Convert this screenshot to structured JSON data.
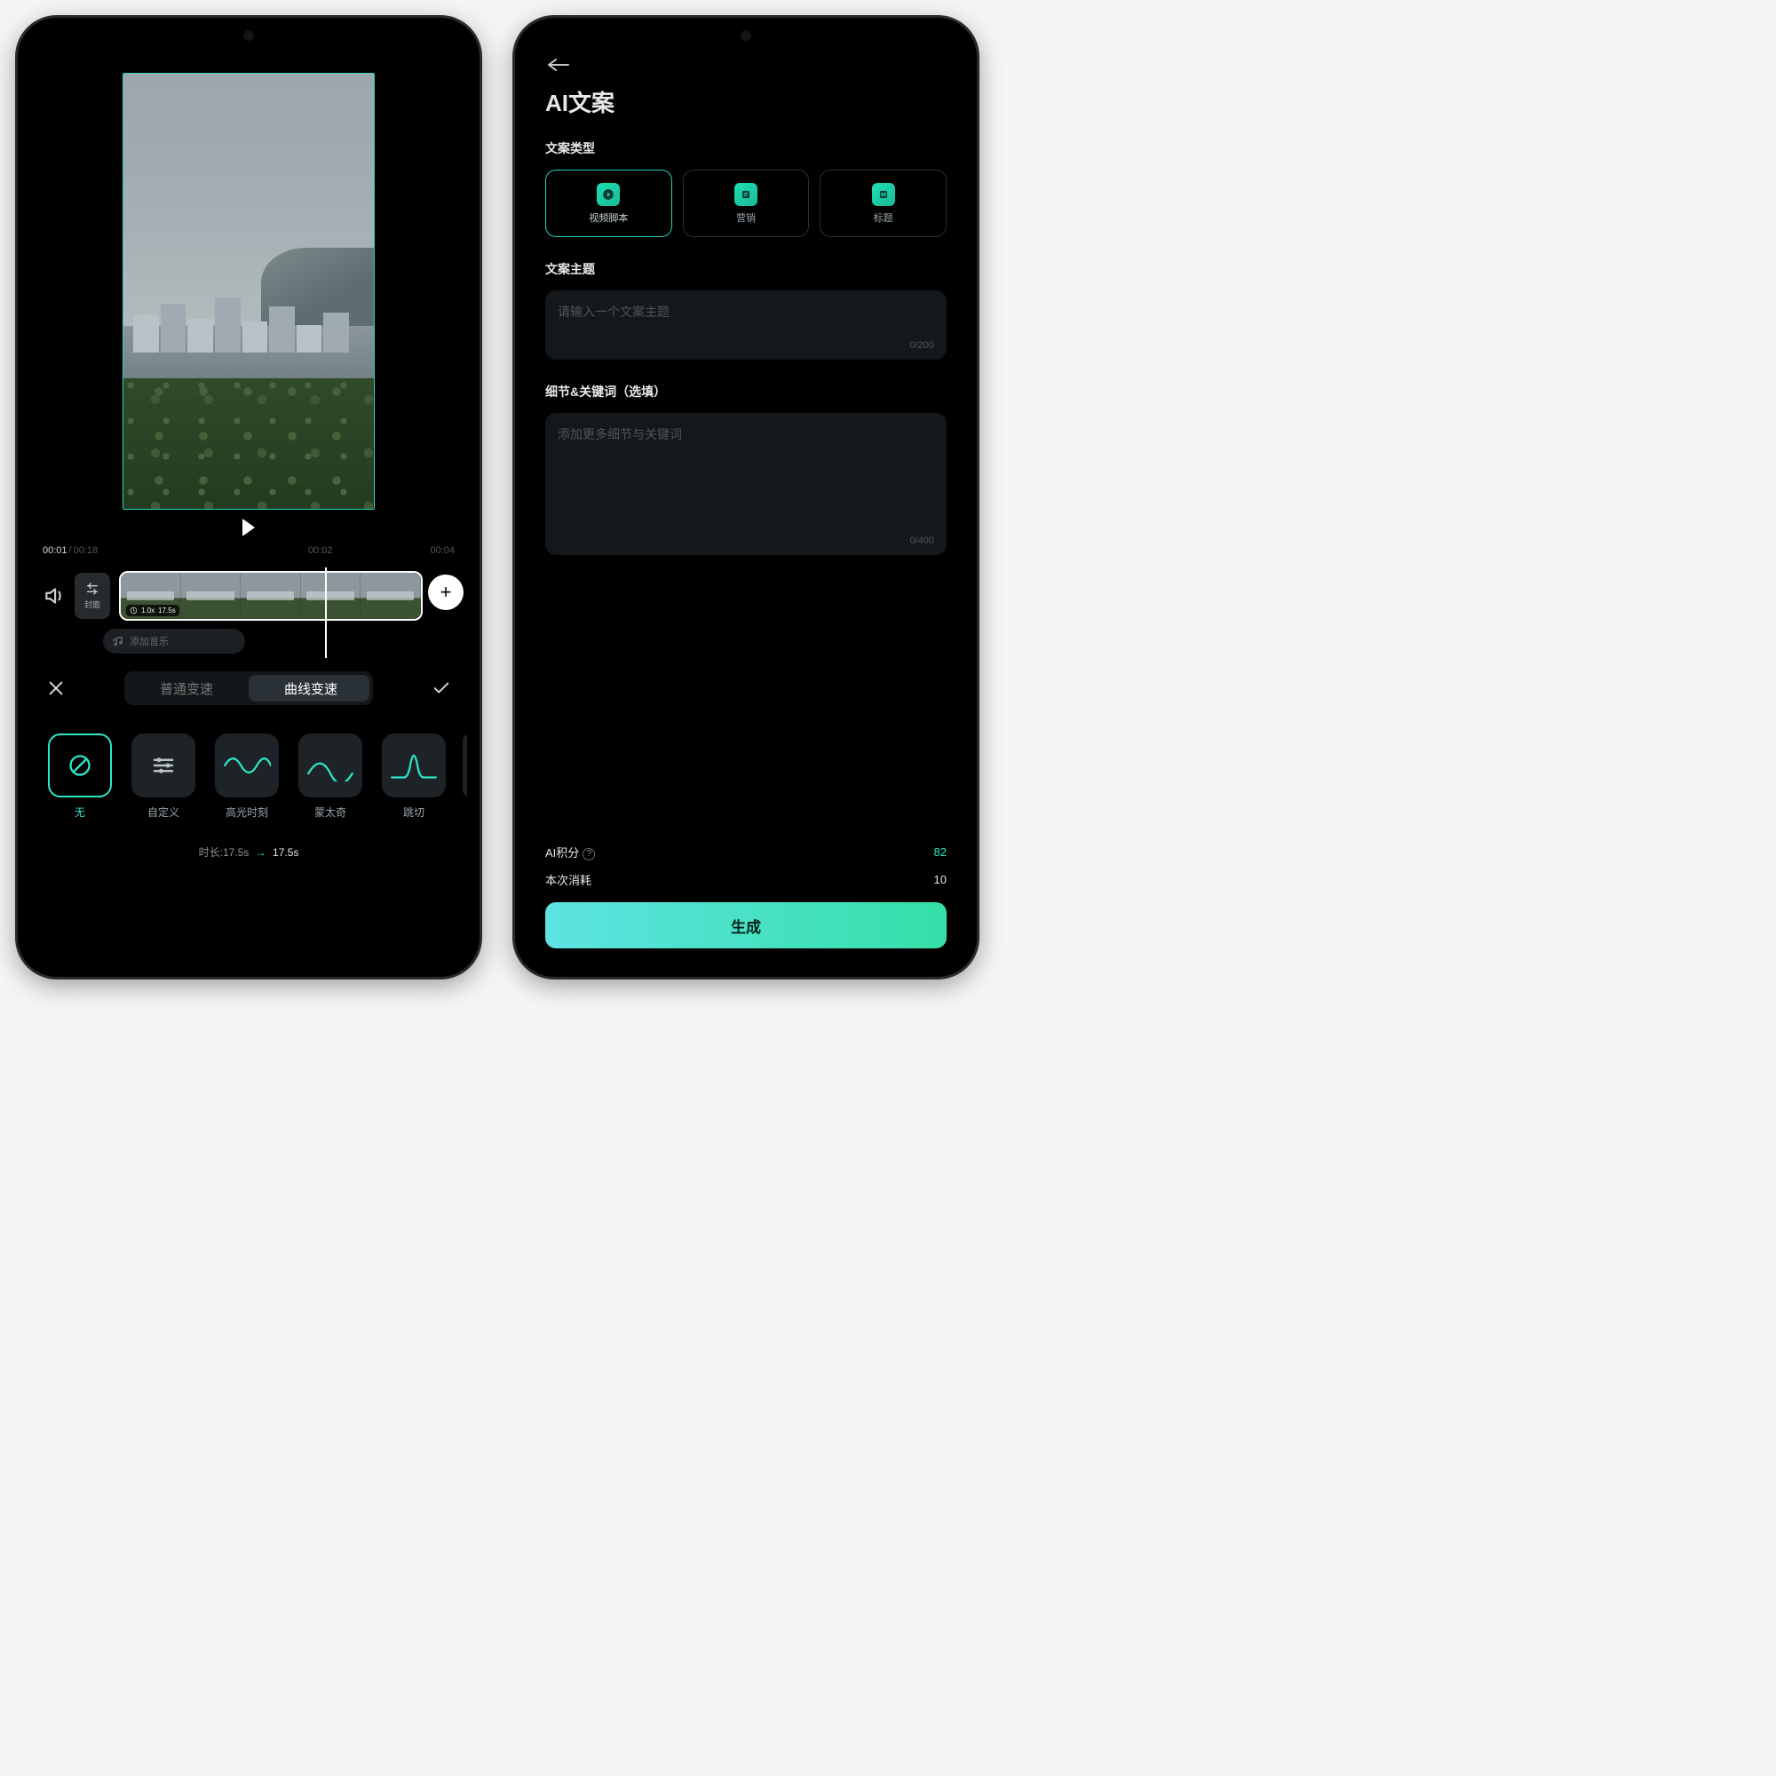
{
  "left": {
    "time_current": "00:01",
    "time_total": "00:18",
    "ruler": [
      "00:02",
      "00:04"
    ],
    "cover_label": "封面",
    "clip_speed_badge": "1.0x",
    "clip_len_badge": "17.5s",
    "add_music_label": "添加音乐",
    "tabs": {
      "normal": "普通变速",
      "curve": "曲线变速"
    },
    "curves": [
      {
        "id": "none",
        "label": "无"
      },
      {
        "id": "custom",
        "label": "自定义"
      },
      {
        "id": "highlight",
        "label": "高光时刻"
      },
      {
        "id": "montage",
        "label": "蒙太奇"
      },
      {
        "id": "jumpcut",
        "label": "跳切"
      }
    ],
    "duration_label": "时长:17.5s",
    "duration_new": "17.5s"
  },
  "right": {
    "title": "AI文案",
    "type_label": "文案类型",
    "types": [
      {
        "id": "script",
        "label": "视频脚本"
      },
      {
        "id": "marketing",
        "label": "营销"
      },
      {
        "id": "title",
        "label": "标题"
      }
    ],
    "theme_label": "文案主题",
    "theme_placeholder": "请输入一个文案主题",
    "theme_count": "0/200",
    "details_label": "细节&关键词（选填）",
    "details_placeholder": "添加更多细节与关键词",
    "details_count": "0/400",
    "credits_label": "AI积分",
    "credits_value": "82",
    "cost_label": "本次消耗",
    "cost_value": "10",
    "generate_label": "生成"
  }
}
